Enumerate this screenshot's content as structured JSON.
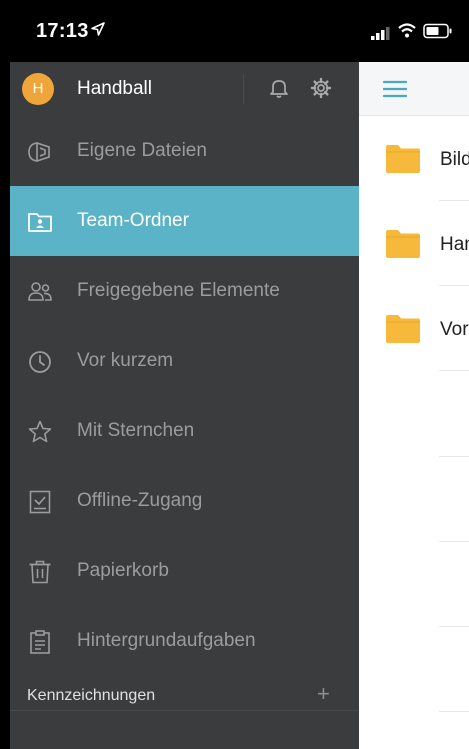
{
  "status_bar": {
    "time": "17:13"
  },
  "sidebar": {
    "avatar_letter": "H",
    "account_name": "Handball",
    "items": [
      {
        "label": "Eigene Dateien",
        "icon": "my-files-icon",
        "active": false
      },
      {
        "label": "Team-Ordner",
        "icon": "team-folder-icon",
        "active": true
      },
      {
        "label": "Freigegebene Elemente",
        "icon": "shared-people-icon",
        "active": false
      },
      {
        "label": "Vor kurzem",
        "icon": "clock-icon",
        "active": false
      },
      {
        "label": "Mit Sternchen",
        "icon": "star-icon",
        "active": false
      },
      {
        "label": "Offline-Zugang",
        "icon": "offline-check-icon",
        "active": false
      },
      {
        "label": "Papierkorb",
        "icon": "trash-icon",
        "active": false
      },
      {
        "label": "Hintergrundaufgaben",
        "icon": "clipboard-icon",
        "active": false
      }
    ],
    "labels_section": {
      "title": "Kennzeichnungen",
      "add": "+"
    }
  },
  "main": {
    "folders": [
      {
        "name": "Bild"
      },
      {
        "name": "Han"
      },
      {
        "name": "Vor"
      }
    ]
  },
  "colors": {
    "sidebar_bg": "#3b3c3e",
    "active_bg": "#5ab3c6",
    "accent": "#4aa9c0",
    "avatar": "#f0a53a",
    "folder": "#f6b93b"
  }
}
